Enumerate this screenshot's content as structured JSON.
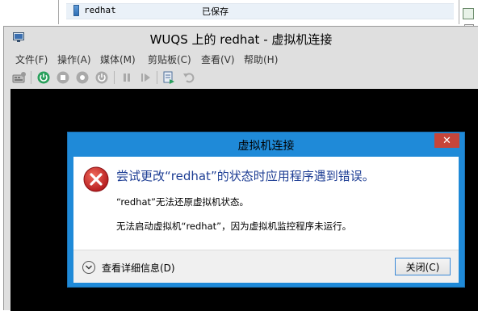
{
  "manager_row": {
    "vm_name": "redhat",
    "state": "已保存"
  },
  "window": {
    "title": "WUQS 上的 redhat - 虚拟机连接",
    "menu": [
      "文件(F)",
      "操作(A)",
      "媒体(M)",
      "剪贴板(C)",
      "查看(V)",
      "帮助(H)"
    ],
    "toolbar_icons": [
      "ctrl-alt-del-icon",
      "start-icon",
      "turn-off-icon",
      "shutdown-icon",
      "save-icon",
      "pause-icon",
      "reset-icon",
      "checkpoint-icon",
      "revert-icon"
    ],
    "screen_color": "#000000"
  },
  "dialog": {
    "title": "虚拟机连接",
    "main_message": "尝试更改“redhat”的状态时应用程序遇到错误。",
    "detail_line1": "“redhat”无法还原虚拟机状态。",
    "detail_line2": "无法启动虚拟机“redhat”，因为虚拟机监控程序未运行。",
    "details_toggle_label": "查看详细信息(D)",
    "close_button_label": "关闭(C)",
    "accent_color": "#1f8ad8",
    "close_x_color": "#c7453a",
    "error_icon": "error-icon"
  }
}
